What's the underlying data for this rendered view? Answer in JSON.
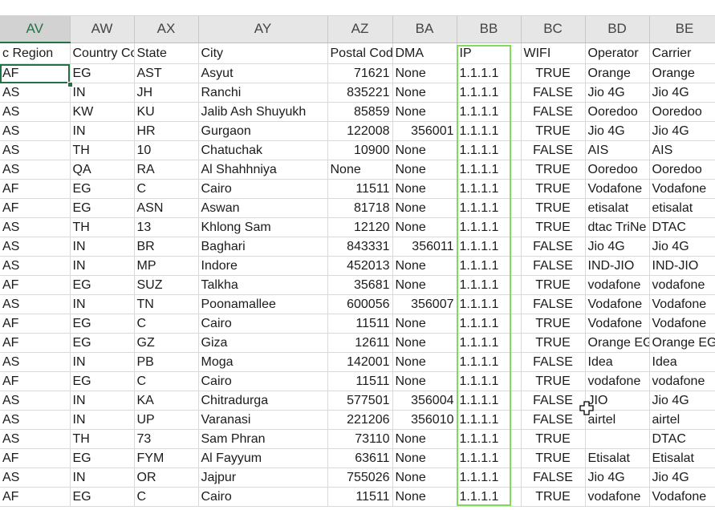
{
  "column_letters": [
    "AV",
    "AW",
    "AX",
    "AY",
    "AZ",
    "BA",
    "BB",
    "BC",
    "BD",
    "BE"
  ],
  "active_column": "AV",
  "headers": [
    "c Region",
    "Country Co",
    "State",
    "City",
    "Postal Cod",
    "DMA",
    "IP",
    "WIFI",
    "Operator",
    "Carrier"
  ],
  "rows": [
    [
      "AF",
      "EG",
      "AST",
      "Asyut",
      "71621",
      "None",
      "1.1.1.1",
      "TRUE",
      "Orange",
      "Orange"
    ],
    [
      "AS",
      "IN",
      "JH",
      "Ranchi",
      "835221",
      "None",
      "1.1.1.1",
      "FALSE",
      "Jio 4G",
      "Jio 4G"
    ],
    [
      "AS",
      "KW",
      "KU",
      "Jalib Ash Shuyukh",
      "85859",
      "None",
      "1.1.1.1",
      "FALSE",
      "Ooredoo",
      "Ooredoo"
    ],
    [
      "AS",
      "IN",
      "HR",
      "Gurgaon",
      "122008",
      "356001",
      "1.1.1.1",
      "TRUE",
      "Jio 4G",
      "Jio 4G"
    ],
    [
      "AS",
      "TH",
      "10",
      "Chatuchak",
      "10900",
      "None",
      "1.1.1.1",
      "FALSE",
      "AIS",
      "AIS"
    ],
    [
      "AS",
      "QA",
      "RA",
      "Al Shahhniya",
      "None",
      "None",
      "1.1.1.1",
      "TRUE",
      "Ooredoo",
      "Ooredoo"
    ],
    [
      "AF",
      "EG",
      "C",
      "Cairo",
      "11511",
      "None",
      "1.1.1.1",
      "TRUE",
      "Vodafone",
      "Vodafone"
    ],
    [
      "AF",
      "EG",
      "ASN",
      "Aswan",
      "81718",
      "None",
      "1.1.1.1",
      "TRUE",
      "etisalat",
      "etisalat"
    ],
    [
      "AS",
      "TH",
      "13",
      "Khlong Sam",
      "12120",
      "None",
      "1.1.1.1",
      "TRUE",
      "dtac TriNe",
      "DTAC"
    ],
    [
      "AS",
      "IN",
      "BR",
      "Baghari",
      "843331",
      "356011",
      "1.1.1.1",
      "FALSE",
      "Jio 4G",
      "Jio 4G"
    ],
    [
      "AS",
      "IN",
      "MP",
      "Indore",
      "452013",
      "None",
      "1.1.1.1",
      "FALSE",
      "IND-JIO",
      "IND-JIO"
    ],
    [
      "AF",
      "EG",
      "SUZ",
      "Talkha",
      "35681",
      "None",
      "1.1.1.1",
      "TRUE",
      "vodafone",
      "vodafone"
    ],
    [
      "AS",
      "IN",
      "TN",
      "Poonamallee",
      "600056",
      "356007",
      "1.1.1.1",
      "FALSE",
      "Vodafone",
      "Vodafone"
    ],
    [
      "AF",
      "EG",
      "C",
      "Cairo",
      "11511",
      "None",
      "1.1.1.1",
      "TRUE",
      "Vodafone",
      "Vodafone"
    ],
    [
      "AF",
      "EG",
      "GZ",
      "Giza",
      "12611",
      "None",
      "1.1.1.1",
      "TRUE",
      "Orange EG",
      "Orange EG"
    ],
    [
      "AS",
      "IN",
      "PB",
      "Moga",
      "142001",
      "None",
      "1.1.1.1",
      "FALSE",
      "Idea",
      "Idea"
    ],
    [
      "AF",
      "EG",
      "C",
      "Cairo",
      "11511",
      "None",
      "1.1.1.1",
      "TRUE",
      "vodafone",
      "vodafone"
    ],
    [
      "AS",
      "IN",
      "KA",
      "Chitradurga",
      "577501",
      "356004",
      "1.1.1.1",
      "FALSE",
      "JIO",
      "Jio 4G"
    ],
    [
      "AS",
      "IN",
      "UP",
      "Varanasi",
      "221206",
      "356010",
      "1.1.1.1",
      "FALSE",
      "airtel",
      "airtel"
    ],
    [
      "AS",
      "TH",
      "73",
      "Sam Phran",
      "73110",
      "None",
      "1.1.1.1",
      "TRUE",
      "",
      "DTAC"
    ],
    [
      "AF",
      "EG",
      "FYM",
      "Al Fayyum",
      "63611",
      "None",
      "1.1.1.1",
      "TRUE",
      "Etisalat",
      "Etisalat"
    ],
    [
      "AS",
      "IN",
      "OR",
      "Jajpur",
      "755026",
      "None",
      "1.1.1.1",
      "FALSE",
      "Jio 4G",
      "Jio 4G"
    ],
    [
      "AF",
      "EG",
      "C",
      "Cairo",
      "11511",
      "None",
      "1.1.1.1",
      "TRUE",
      "vodafone",
      "Vodafone"
    ]
  ],
  "colors": {
    "accent": "#217346",
    "highlight": "#7ddc5a"
  },
  "icons": {
    "cursor": "cell-select-cross-cursor-icon"
  }
}
